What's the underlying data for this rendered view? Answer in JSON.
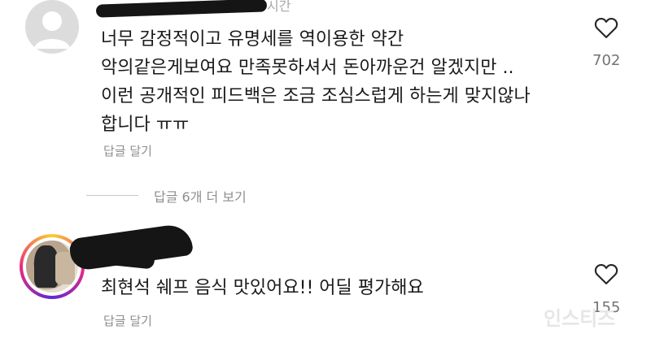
{
  "comments": [
    {
      "username_tail": "시간",
      "lines": [
        "너무 감정적이고 유명세를 역이용한 약간",
        "악의같은게보여요 만족못하셔서 돈아까운건 알겠지만 ..",
        "이런 공개적인 피드백은 조금 조심스럽게 하는게 맞지않나",
        "합니다 ㅠㅠ"
      ],
      "reply_label": "답글 달기",
      "like_count": "702"
    },
    {
      "lines": [
        "최현석 쉐프 음식 맛있어요!! 어딜 평가해요"
      ],
      "reply_label": "답글 달기",
      "like_count": "155"
    }
  ],
  "view_replies_label": "답글 6개 더 보기",
  "watermark": "인스티즈",
  "icons": {
    "like": "heart-outline-icon",
    "avatar": "default-avatar-icon"
  }
}
